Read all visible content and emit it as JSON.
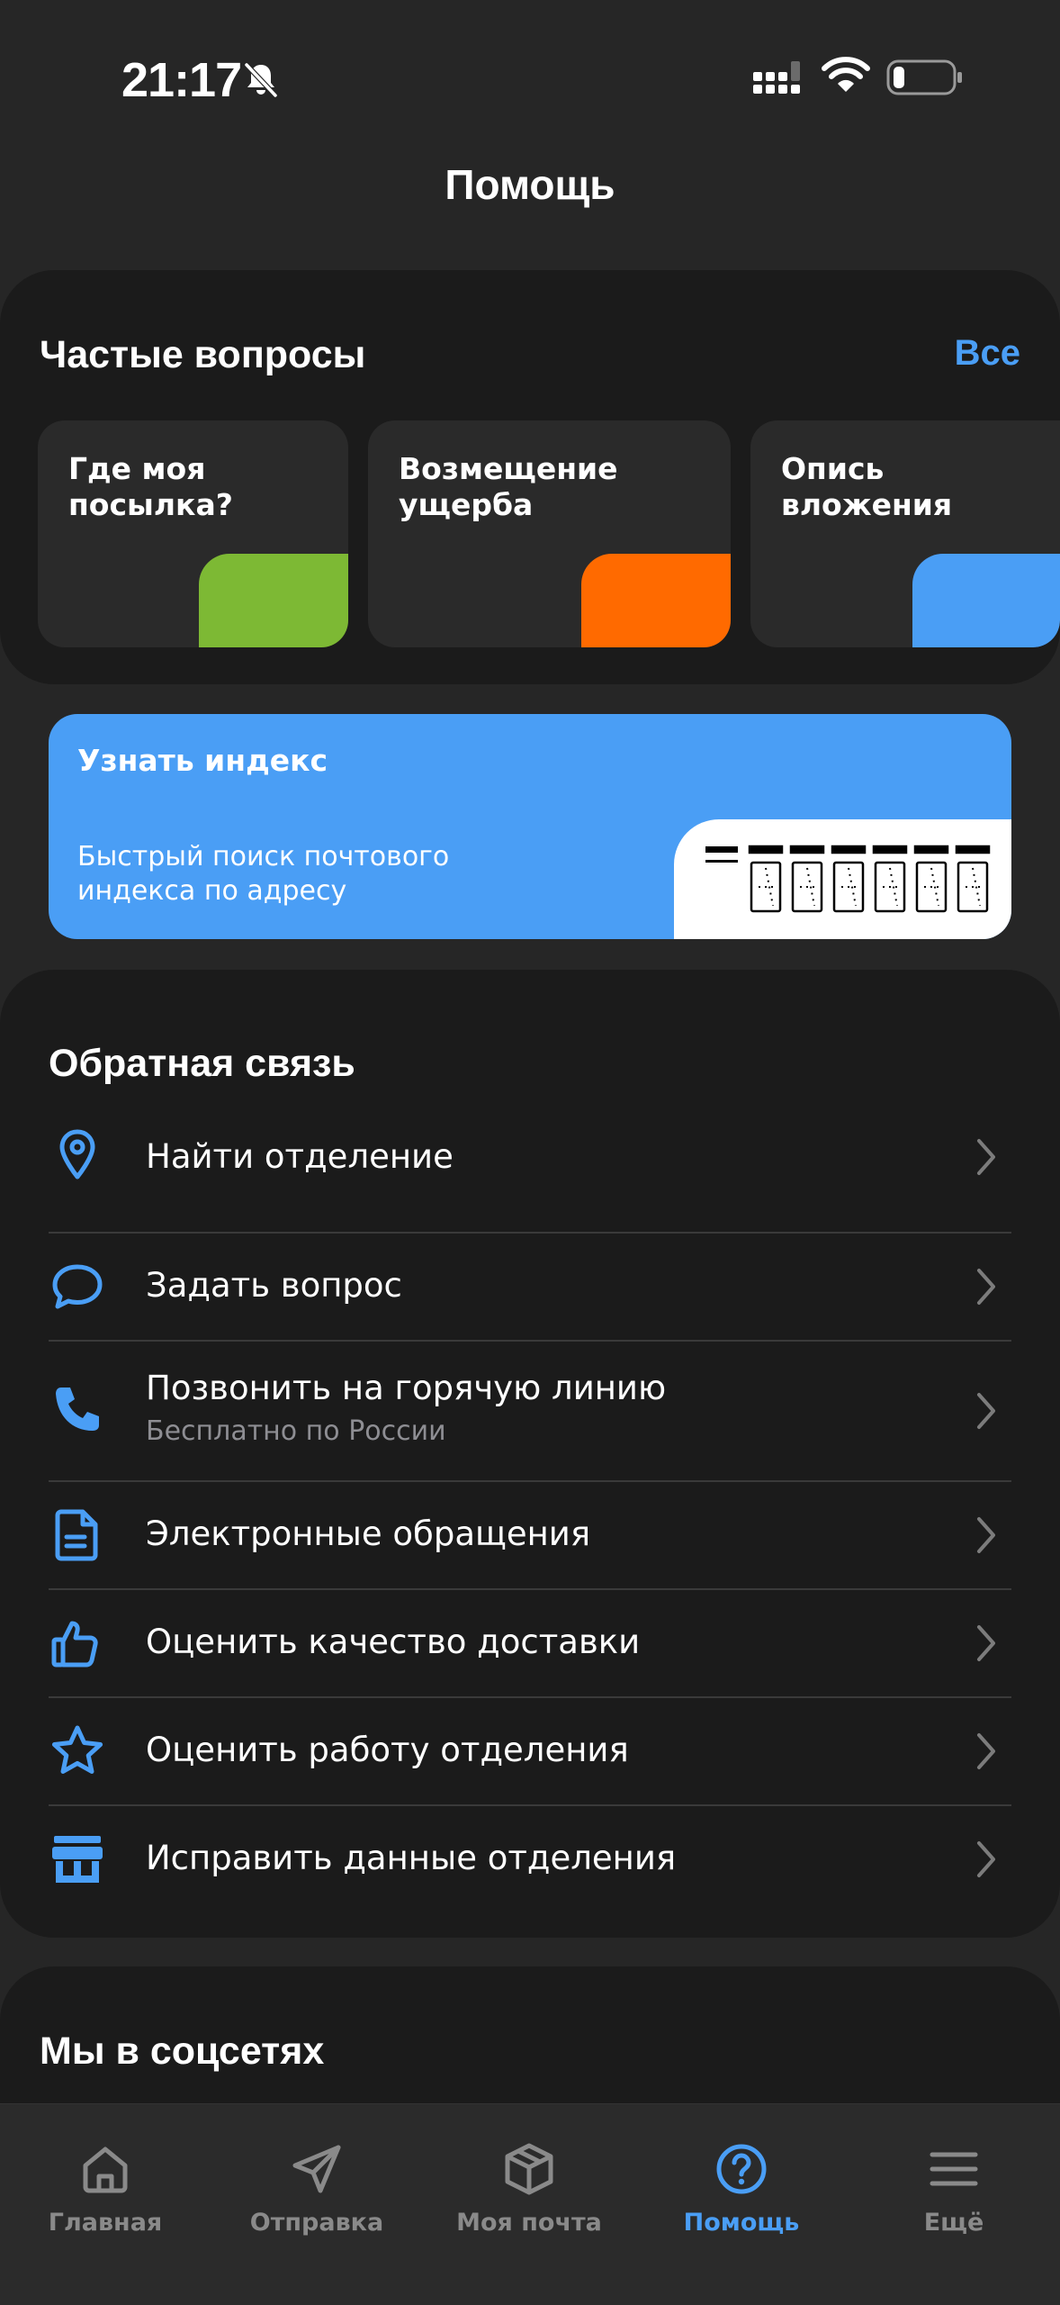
{
  "status_bar": {
    "time": "21:17",
    "icons": [
      "bell-slash-icon",
      "signal-icon",
      "wifi-icon",
      "battery-icon"
    ]
  },
  "header": {
    "title": "Помощь"
  },
  "faq": {
    "title": "Частые вопросы",
    "all_link": "Все",
    "tiles": [
      {
        "label": "Где моя посылка?",
        "accent_color": "#7db934"
      },
      {
        "label": "Возмещение ущерба",
        "accent_color": "#ff6a00"
      },
      {
        "label": "Опись вложения",
        "accent_color": "#4a9ef5"
      }
    ]
  },
  "index_banner": {
    "title": "Узнать индекс",
    "description": "Быстрый поиск почтового индекса по адресу",
    "background_color": "#4a9ef5"
  },
  "feedback": {
    "title": "Обратная связь",
    "items": [
      {
        "label": "Найти отделение",
        "icon": "location-pin-icon"
      },
      {
        "label": "Задать вопрос",
        "icon": "chat-bubble-icon"
      },
      {
        "label": "Позвонить на горячую линию",
        "sublabel": "Бесплатно по России",
        "icon": "phone-icon"
      },
      {
        "label": "Электронные обращения",
        "icon": "document-icon"
      },
      {
        "label": "Оценить качество доставки",
        "icon": "thumbs-up-icon"
      },
      {
        "label": "Оценить работу отделения",
        "icon": "star-icon"
      },
      {
        "label": "Исправить данные отделения",
        "icon": "storefront-icon"
      }
    ]
  },
  "social": {
    "title": "Мы в соцсетях"
  },
  "tab_bar": {
    "tabs": [
      {
        "label": "Главная",
        "icon": "home-icon",
        "active": false
      },
      {
        "label": "Отправка",
        "icon": "send-icon",
        "active": false
      },
      {
        "label": "Моя почта",
        "icon": "package-icon",
        "active": false
      },
      {
        "label": "Помощь",
        "icon": "help-circle-icon",
        "active": true
      },
      {
        "label": "Ещё",
        "icon": "menu-icon",
        "active": false
      }
    ]
  },
  "colors": {
    "accent": "#4a9ef5",
    "background": "#262626",
    "card": "#1b1b1b",
    "inactive": "#8a8a8a"
  }
}
